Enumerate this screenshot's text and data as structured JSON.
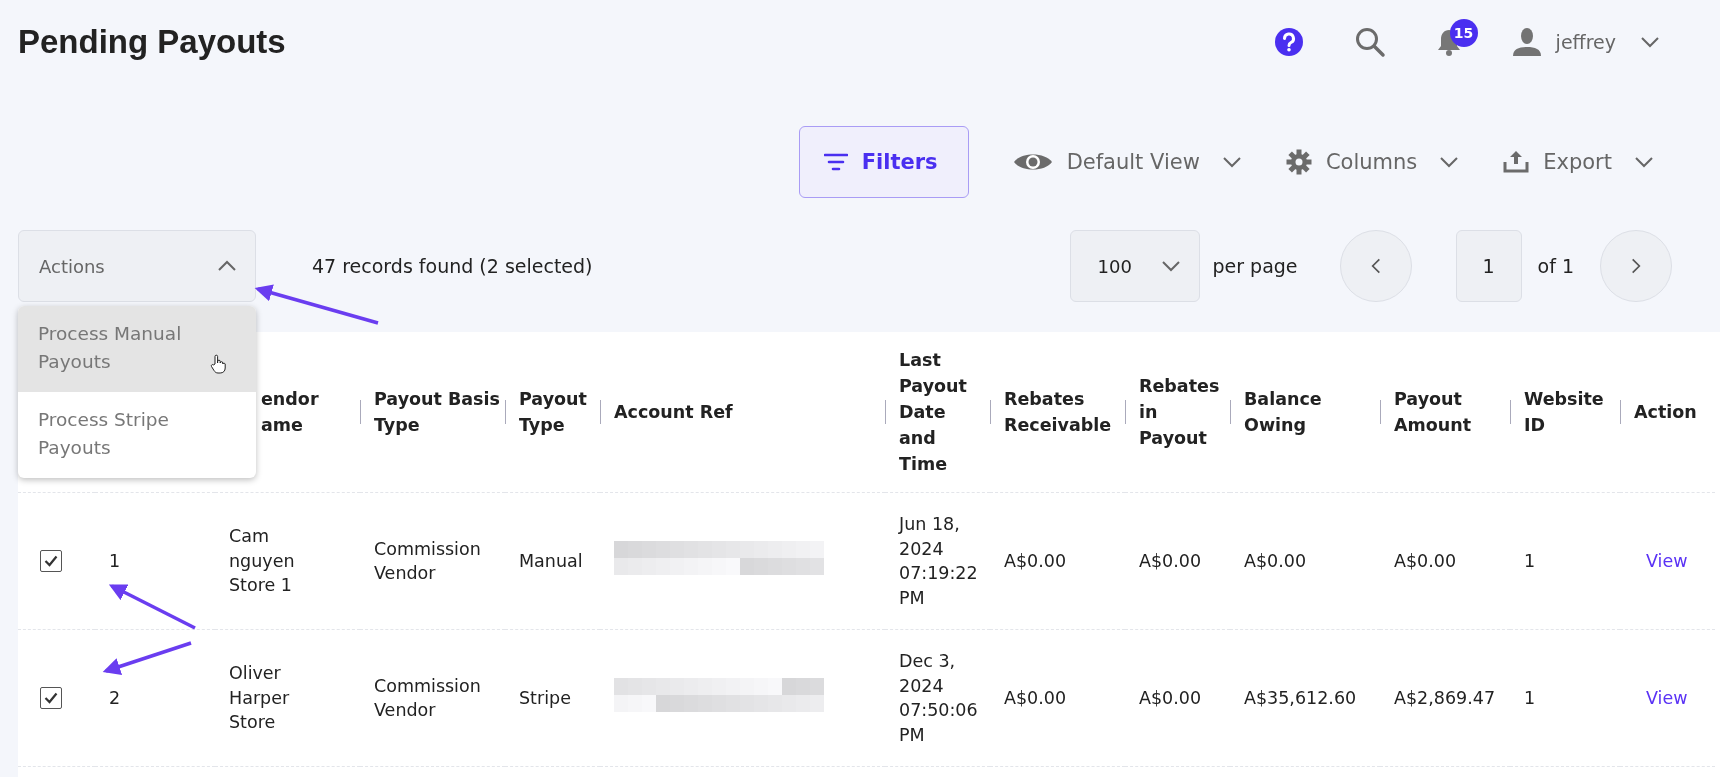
{
  "page": {
    "title": "Pending Payouts"
  },
  "header": {
    "notifications_count": "15",
    "user_name": "jeffrey"
  },
  "toolbar": {
    "filters": "Filters",
    "view": "Default View",
    "columns": "Columns",
    "export": "Export"
  },
  "actions": {
    "label": "Actions",
    "expanded": true,
    "options": [
      {
        "label": "Process Manual Payouts",
        "hovered": true
      },
      {
        "label": "Process Stripe Payouts",
        "hovered": false
      }
    ]
  },
  "records_summary": "47 records found (2 selected)",
  "pagination": {
    "per_page": "100",
    "per_page_label": "per page",
    "page": "1",
    "of_label": "of 1"
  },
  "table": {
    "columns": [
      "endor ame",
      "Payout Basis Type",
      "Payout Type",
      "Account Ref",
      "Last Payout Date and Time",
      "Rebates Receivable",
      "Rebates in Payout",
      "Balance Owing",
      "Payout Amount",
      "Website ID",
      "Action"
    ],
    "rows": [
      {
        "selected": true,
        "number": "1",
        "vendor_name": "Cam nguyen Store 1",
        "basis_type": "Commission Vendor",
        "payout_type": "Manual",
        "account_ref_redacted": true,
        "last_payout": "Jun 18, 2024 07:19:22 PM",
        "rebates_receivable": "A$0.00",
        "rebates_in_payout": "A$0.00",
        "balance_owing": "A$0.00",
        "payout_amount": "A$0.00",
        "website_id": "1",
        "action": "View"
      },
      {
        "selected": true,
        "number": "2",
        "vendor_name": "Oliver Harper Store",
        "basis_type": "Commission Vendor",
        "payout_type": "Stripe",
        "account_ref_redacted": true,
        "last_payout": "Dec 3, 2024 07:50:06 PM",
        "rebates_receivable": "A$0.00",
        "rebates_in_payout": "A$0.00",
        "balance_owing": "A$35,612.60",
        "payout_amount": "A$2,869.47",
        "website_id": "1",
        "action": "View"
      }
    ]
  }
}
